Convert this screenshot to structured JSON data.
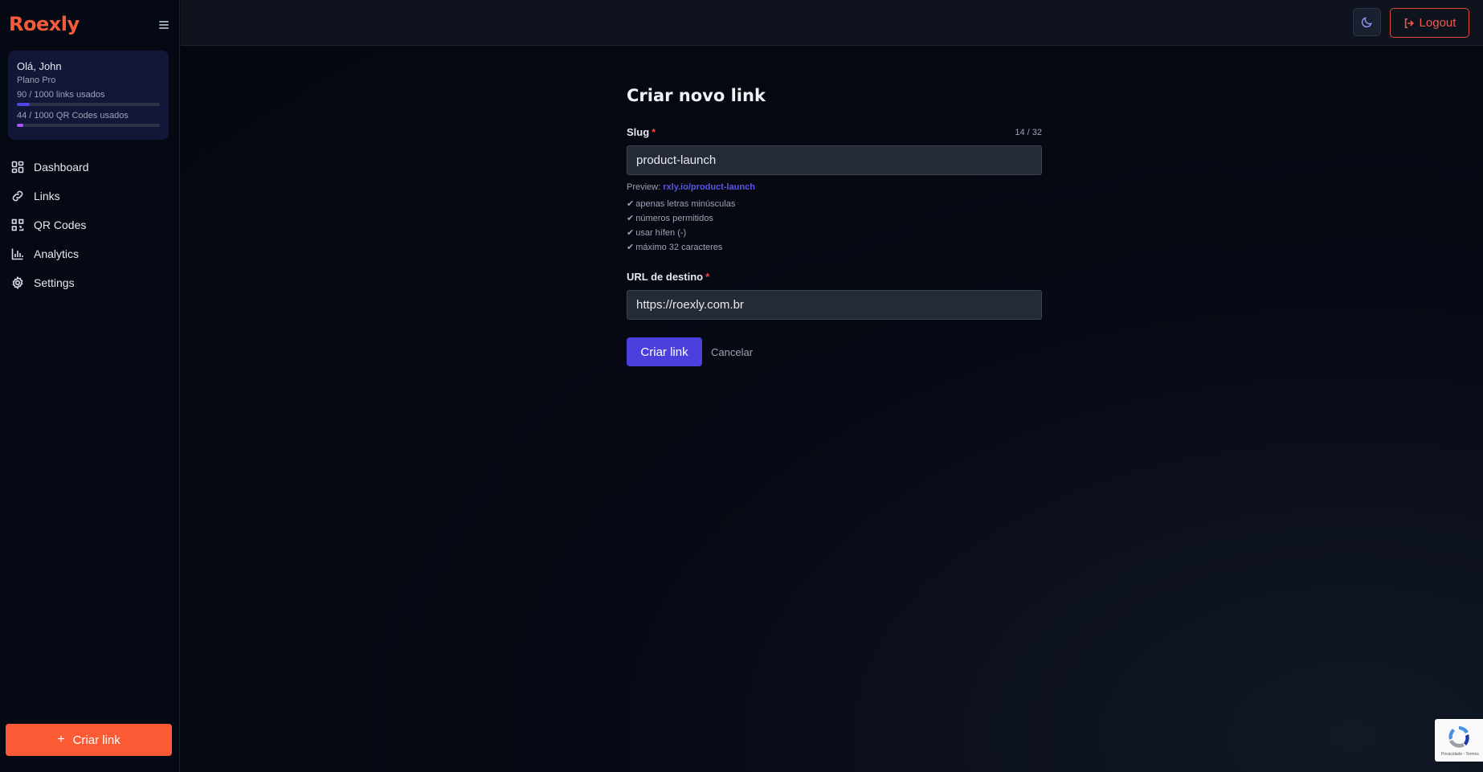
{
  "app": {
    "brand": "Roexly"
  },
  "user": {
    "greeting": "Olá, John",
    "plan": "Plano Pro",
    "links_usage": {
      "label": "90 / 1000 links usados",
      "used": 90,
      "total": 1000,
      "color": "#4f46e5"
    },
    "qr_usage": {
      "label": "44 / 1000 QR Codes usados",
      "used": 44,
      "total": 1000,
      "color": "#a855f7"
    }
  },
  "nav": {
    "items": [
      {
        "label": "Dashboard",
        "icon": "dashboard-icon"
      },
      {
        "label": "Links",
        "icon": "link-icon"
      },
      {
        "label": "QR Codes",
        "icon": "qr-code-icon"
      },
      {
        "label": "Analytics",
        "icon": "bar-chart-icon"
      },
      {
        "label": "Settings",
        "icon": "gear-icon"
      }
    ]
  },
  "sidebar_cta": {
    "label": "Criar link",
    "color": "#fb5a34"
  },
  "header": {
    "logout_label": "Logout",
    "theme_icon": "moon-icon"
  },
  "form": {
    "title": "Criar novo link",
    "slug": {
      "label": "Slug",
      "required_mark": "*",
      "counter": "14 / 32",
      "value": "product-launch",
      "preview_label": "Preview:",
      "preview_url": "rxly.io/product-launch",
      "rules": [
        "apenas letras minúsculas",
        "números permitidos",
        "usar hífen (-)",
        "máximo 32 caracteres"
      ]
    },
    "url": {
      "label": "URL de destino",
      "required_mark": "*",
      "value": "https://roexly.com.br"
    },
    "submit_label": "Criar link",
    "cancel_label": "Cancelar",
    "accent": "#4b40de"
  },
  "recaptcha": {
    "terms": "Privacidade - Termos"
  }
}
